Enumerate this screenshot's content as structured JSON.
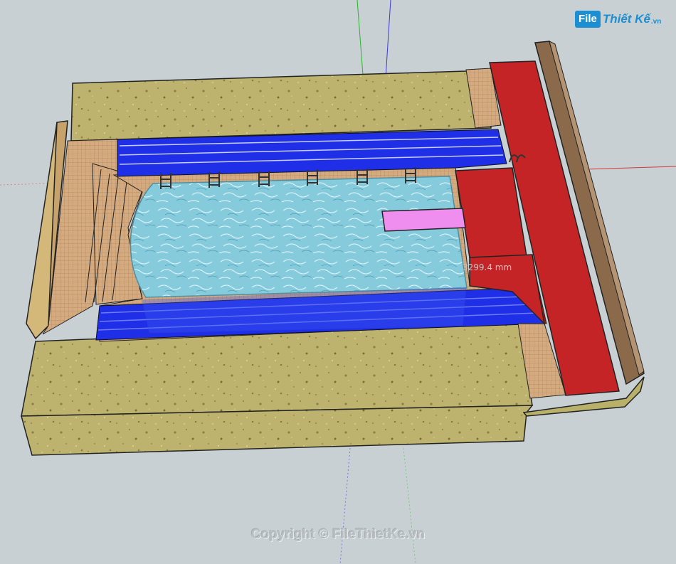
{
  "watermark": {
    "logo_box": "File",
    "logo_rest": "Thiết Kế",
    "logo_tld": ".vn",
    "copyright": "Copyright © FileThietKe.vn"
  },
  "model": {
    "dimension_label": "3299.4 mm"
  },
  "colors": {
    "background": "#c8d0d4",
    "ground": "#b9b06a",
    "pool_water": "#7ec8da",
    "deck_tile": "#d2a87e",
    "gutter_glass": "#1f2fe8",
    "platform": "#c42425",
    "diving_board": "#f08ef0",
    "axis_green": "#2bb52b",
    "axis_blue": "#3a3ad8",
    "axis_red": "#d23a3a"
  },
  "icons": [
    "pool-ladder-icon"
  ]
}
